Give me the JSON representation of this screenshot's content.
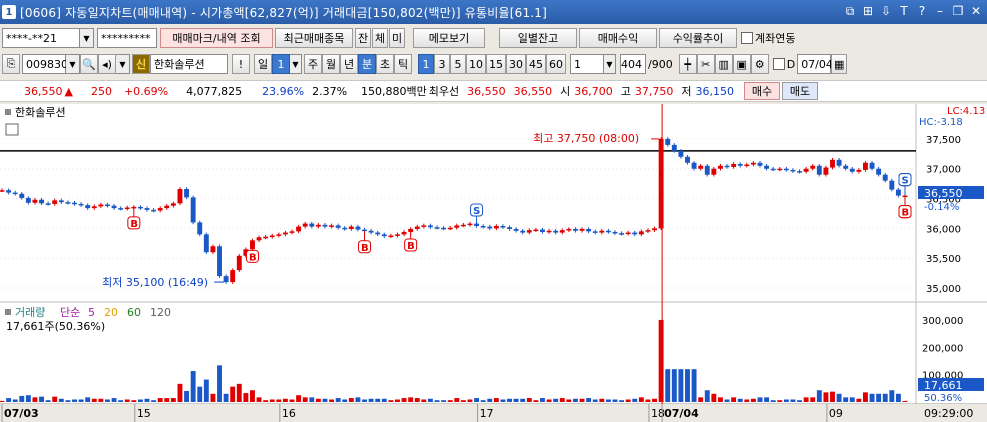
{
  "window": {
    "title": "[0606] 자동일지차트(매매내역) - 시가총액[62,827(억)] 거래대금[150,802(백만)] 유통비율[61.1]",
    "app_number": "1"
  },
  "toolbar1": {
    "account": "****-**21",
    "password": "*********",
    "trade_mark_btn": "매매마크/내역 조회",
    "recent_trades_btn": "최근매매종목",
    "balance_btn": "잔",
    "exec_btn": "체",
    "unexec_btn": "미",
    "memo_btn": "메모보기",
    "daily_balance_btn": "일별잔고",
    "trade_profit_btn": "매매수익",
    "return_trend_btn": "수익률추이",
    "account_link_label": "계좌연동"
  },
  "toolbar2": {
    "code": "009830",
    "credit_badge": "신",
    "stock_name": "한화솔루션",
    "exclaim": "!",
    "period_day": "일",
    "period_value": "1",
    "week": "주",
    "month": "월",
    "year": "년",
    "minute": "분",
    "second": "초",
    "tick": "틱",
    "intervals": [
      "1",
      "3",
      "5",
      "10",
      "15",
      "30",
      "45",
      "60"
    ],
    "unit_value": "1",
    "count": "404",
    "count_total": "/900",
    "d_label": "D",
    "date": "07/04"
  },
  "quote": {
    "price": "36,550",
    "change_arrow": "▲",
    "change": "250",
    "change_pct": "+0.69%",
    "volume": "4,077,825",
    "vol_ratio": "23.96%",
    "turnover": "2.37%",
    "amount": "150,880백만",
    "best_label": "최우선",
    "ask": "36,550",
    "bid": "36,550",
    "open_label": "시",
    "open": "36,700",
    "high_label": "고",
    "high": "37,750",
    "low_label": "저",
    "low": "36,150",
    "buy_btn": "매수",
    "sell_btn": "매도"
  },
  "chart_data": {
    "type": "candlestick",
    "title": "한화솔루션",
    "lc_label": "LC:4.13",
    "hc_label": "HC:-3.18",
    "price_axis": {
      "ticks": [
        "37,500",
        "37,000",
        "36,500",
        "36,000",
        "35,500",
        "35,000"
      ],
      "ylim": [
        34900,
        37750
      ]
    },
    "current_price": "36,550",
    "current_change": "-0.14%",
    "high_annotation": "최고 37,750 (08:00)",
    "low_annotation": "최저 35,100 (16:49)",
    "x_ticks": [
      "07/03",
      "15",
      "16",
      "17",
      "18",
      "07/04",
      "09"
    ],
    "time_label": "09:29:00",
    "reference_line": 37300,
    "price_series": [
      36640,
      36600,
      36580,
      36510,
      36430,
      36480,
      36420,
      36410,
      36470,
      36440,
      36430,
      36410,
      36390,
      36340,
      36370,
      36400,
      36380,
      36340,
      36330,
      36350,
      36360,
      36340,
      36310,
      36300,
      36340,
      36380,
      36420,
      36660,
      36520,
      36100,
      35900,
      35600,
      35700,
      35200,
      35100,
      35300,
      35540,
      35650,
      35800,
      35850,
      35860,
      35880,
      35900,
      35930,
      35950,
      36030,
      36080,
      36030,
      36060,
      36030,
      36050,
      36010,
      35990,
      36030,
      35980,
      35960,
      35930,
      35900,
      35870,
      35880,
      35900,
      35940,
      35990,
      36030,
      36050,
      36020,
      36010,
      36000,
      36010,
      36050,
      36060,
      36080,
      36040,
      36030,
      36000,
      36040,
      36020,
      35990,
      35960,
      35930,
      35970,
      35980,
      35940,
      35960,
      35930,
      35970,
      35990,
      35960,
      35990,
      35950,
      35930,
      35960,
      35940,
      35920,
      35910,
      35930,
      35900,
      35950,
      35970,
      36000,
      37500,
      37400,
      37300,
      37200,
      37100,
      37000,
      37050,
      36900,
      37000,
      37050,
      37030,
      37080,
      37050,
      37070,
      37100,
      37050,
      37000,
      36990,
      37000,
      36980,
      36960,
      36950,
      37000,
      37050,
      36900,
      37020,
      37150,
      37050,
      37000,
      36950,
      36980,
      37100,
      37000,
      36900,
      36800,
      36650,
      36550,
      36550
    ],
    "trade_markers": [
      {
        "type": "B",
        "index": 20
      },
      {
        "type": "B",
        "index": 38
      },
      {
        "type": "B",
        "index": 55
      },
      {
        "type": "B",
        "index": 62
      },
      {
        "type": "S",
        "index": 72
      },
      {
        "type": "S",
        "index": 148
      },
      {
        "type": "B",
        "index": 150
      },
      {
        "type": "S",
        "index": 190
      },
      {
        "type": "B",
        "index": 195
      },
      {
        "type": "S",
        "index": 197
      },
      {
        "type": "S",
        "index": 203
      },
      {
        "type": "B",
        "index": 199
      },
      {
        "type": "S",
        "index": 207
      },
      {
        "type": "B",
        "index": 210
      },
      {
        "type": "S",
        "index": 213
      }
    ],
    "volume_panel": {
      "label": "거래량",
      "ma_label": "단순",
      "ma_periods": [
        "5",
        "20",
        "60",
        "120"
      ],
      "ma_colors": [
        "#a020a0",
        "#e0a000",
        "#208020",
        "#606060"
      ],
      "value_label": "17,661주(50.36%)",
      "axis_ticks": [
        "300,000",
        "200,000",
        "100,000"
      ],
      "current_value": "17,661",
      "current_pct": "50.36%"
    },
    "colors": {
      "up": "#e00000",
      "down": "#1a58c8",
      "line": "#0b3fc8"
    }
  }
}
